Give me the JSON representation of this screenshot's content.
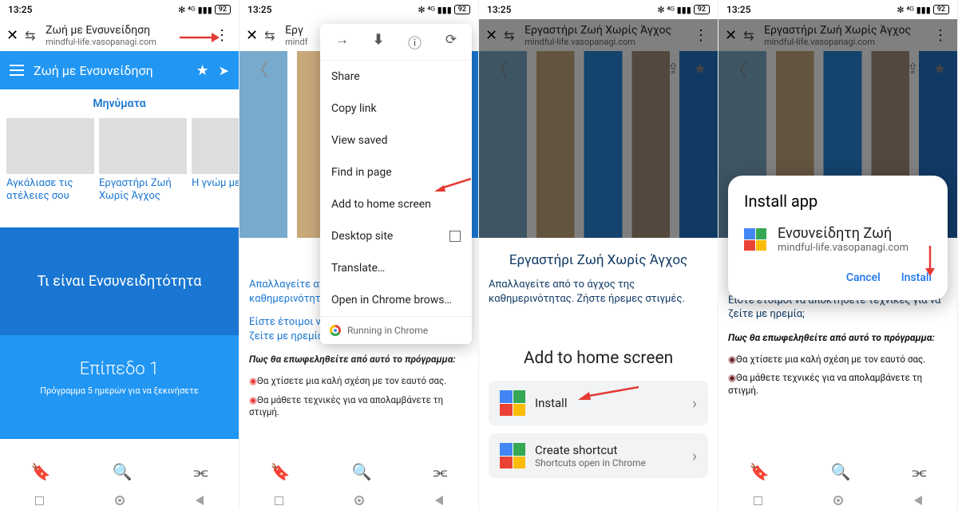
{
  "status": {
    "time": "13:25",
    "bt": "✻",
    "sig": "📶",
    "batt": "92"
  },
  "ctab": {
    "title1": "Ζωή με Ενσυνείδηση",
    "title2": "Εργ",
    "title3": "Εργαστήρι Ζωή Χωρίς Άγχος",
    "title4": "Εργαστήρι Ζωή Χωρίς Άγχος",
    "sub": "mindful-life.vasopanagi.com"
  },
  "appHeader": {
    "title": "Ζωή με Ενσυνείδηση"
  },
  "messages": {
    "heading": "Μηνύματα",
    "cards": [
      {
        "caption": "Αγκάλιασε τις ατέλειες σου"
      },
      {
        "caption": "Εργαστήρι Ζωή Χωρίς Άγχος"
      },
      {
        "caption": "Η γνώμ μετρά"
      }
    ]
  },
  "promo": {
    "title1": "Τι είναι Ενσυνειδητότητα",
    "level": "Επίπεδο 1",
    "desc": "Πρόγραμμα 5 ημερών για να ξεκινήσετε"
  },
  "menu": {
    "items": [
      "Share",
      "Copy link",
      "View saved",
      "Find in page",
      "Add to home screen",
      "Desktop site",
      "Translate…",
      "Open in Chrome brows…"
    ],
    "footer": "Running in Chrome",
    "forward": "→",
    "download": "⬇",
    "info": "ⓘ",
    "reload": "⟳"
  },
  "article": {
    "title": "Εργαστήρι Ζωή Χωρίς Άγχος",
    "p1": "Απαλλαγείτε από το άγχος της καθημερινότητας. Ζήστε ήρεμες στιγμές.",
    "p2": "Είστε έτοιμοι να αποκτήσετε τεχνικές για να ζείτε με ηρεμία;",
    "boldline": "Πως θα επωφεληθείτε από αυτό το πρόγραμμα:",
    "b1": "Θα χτίσετε μια καλή σχέση με τον εαυτό σας.",
    "b2": "Θα μάθετε τεχνικές για να απολαμβάνετε τη στιγμή."
  },
  "sheet": {
    "title": "Add to home screen",
    "install": "Install",
    "shortcut": "Create shortcut",
    "shortcutSub": "Shortcuts open in Chrome"
  },
  "dialog": {
    "title": "Install app",
    "appName": "Ενσυνείδητη Ζωή",
    "appUrl": "mindful-life.vasopanagi.com",
    "cancel": "Cancel",
    "install": "Install"
  }
}
